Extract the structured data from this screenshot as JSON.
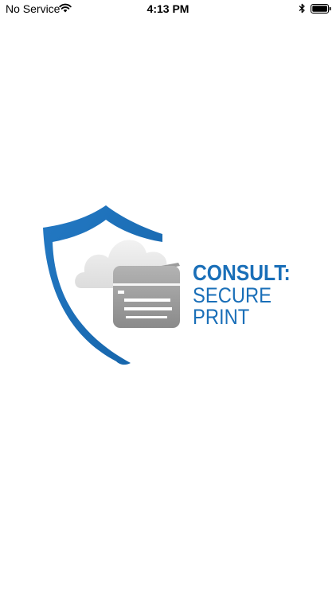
{
  "status_bar": {
    "carrier": "No Service",
    "time": "4:13 PM",
    "wifi_icon": "wifi-icon",
    "bluetooth_icon": "bluetooth-icon",
    "battery_icon": "battery-icon"
  },
  "logo": {
    "brand_name": "CONSULT:",
    "tagline_line1": "SECURE",
    "tagline_line2": "PRINT",
    "colors": {
      "brand_blue": "#1a6fb8",
      "cloud_gray": "#e8e8e8",
      "printer_gray": "#9a9a9a"
    },
    "icons": [
      "shield-icon",
      "cloud-icon",
      "printer-icon"
    ]
  }
}
